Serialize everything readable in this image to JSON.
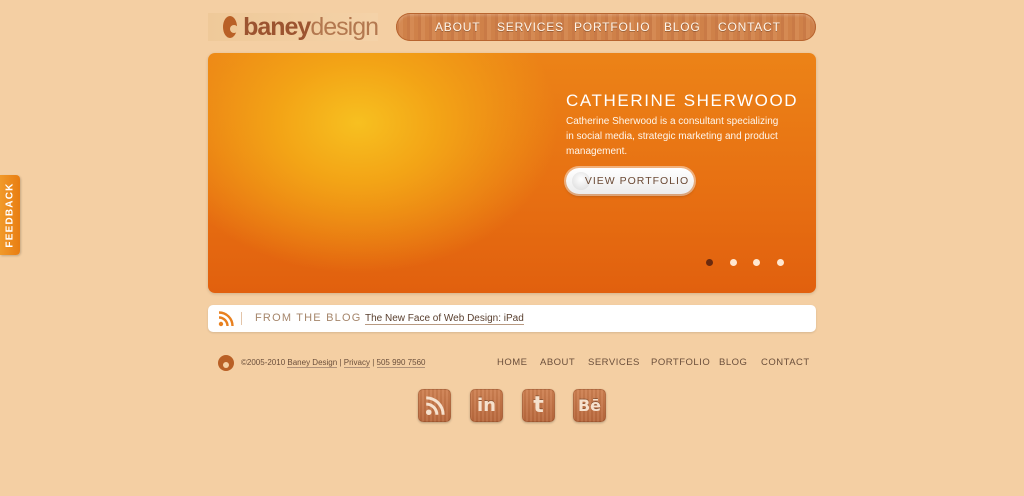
{
  "header": {
    "logo_bold": "baney",
    "logo_light": "design",
    "nav": [
      "ABOUT",
      "SERVICES",
      "PORTFOLIO",
      "BLOG",
      "CONTACT"
    ]
  },
  "hero": {
    "title": "CATHERINE SHERWOOD",
    "description": "Catherine Sherwood is a consultant specializing in social media, strategic marketing and product management.",
    "button_label": "VIEW PORTFOLIO",
    "slides_count": 4,
    "active_slide": 1
  },
  "blog": {
    "label": "FROM THE BLOG",
    "latest_post": "The New Face of Web Design: iPad"
  },
  "footer": {
    "copyright": "©2005-2010",
    "company_link": "Baney Design",
    "privacy_link": "Privacy",
    "phone_link": "505 990 7560",
    "separator": "|",
    "nav": [
      "HOME",
      "ABOUT",
      "SERVICES",
      "PORTFOLIO",
      "BLOG",
      "CONTACT"
    ],
    "social": [
      {
        "name": "rss-icon",
        "glyph": ""
      },
      {
        "name": "linkedin-icon",
        "glyph": "in"
      },
      {
        "name": "twitter-icon",
        "glyph": "t"
      },
      {
        "name": "behance-icon",
        "glyph": "Bē"
      }
    ]
  },
  "feedback": {
    "label": "FEEDBACK"
  },
  "colors": {
    "page_bg": "#f4cfa3",
    "accent_orange": "#e76f12",
    "hero_glow": "#f7c020",
    "wood_brown": "#b9683c",
    "text_brown": "#6b4f3b"
  }
}
